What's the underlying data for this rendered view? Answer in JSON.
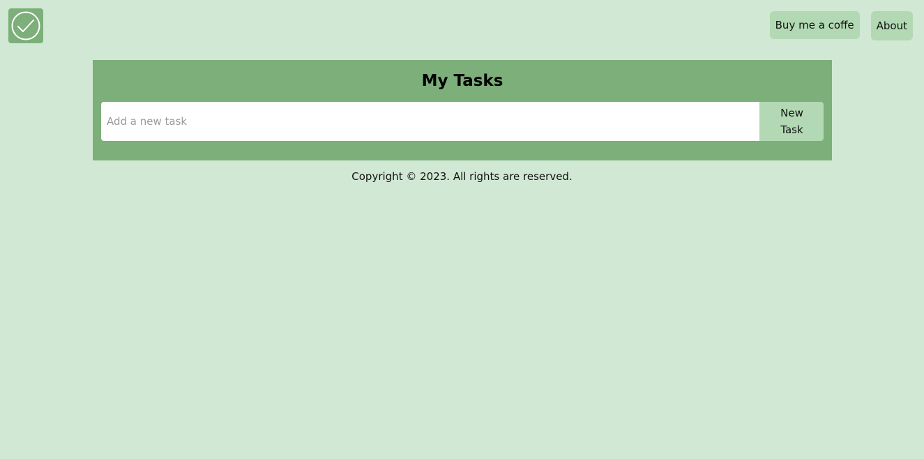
{
  "header": {
    "logo_icon": "check-circle-icon",
    "nav": {
      "coffee_label": "Buy me a coffe",
      "about_label": "About"
    }
  },
  "main": {
    "title": "My Tasks",
    "input_placeholder": "Add a new task",
    "input_value": "",
    "new_task_label": "New Task"
  },
  "footer": {
    "copyright": "Copyright © 2023. All rights are reserved."
  },
  "colors": {
    "background": "#d1e8d4",
    "panel": "#7caf7a",
    "button": "#b2d9b3"
  }
}
